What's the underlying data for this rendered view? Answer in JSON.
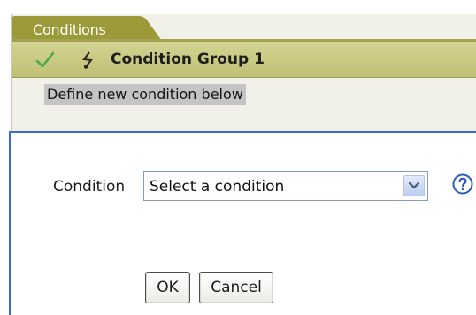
{
  "tab": {
    "label": "Conditions"
  },
  "group": {
    "title": "Condition Group 1"
  },
  "define": {
    "label": "Define new condition below"
  },
  "condition": {
    "label": "Condition",
    "selected": "Select a condition"
  },
  "buttons": {
    "ok": "OK",
    "cancel": "Cancel"
  },
  "icons": {
    "check": "check-icon",
    "lightning": "lightning-icon",
    "help": "help-icon",
    "dropdown": "chevron-down-icon"
  },
  "colors": {
    "tab": "#9c9a38",
    "header": "#c8c880",
    "panel_border": "#3d6cc7",
    "check": "#4ca84c",
    "help": "#2a5bb8"
  }
}
